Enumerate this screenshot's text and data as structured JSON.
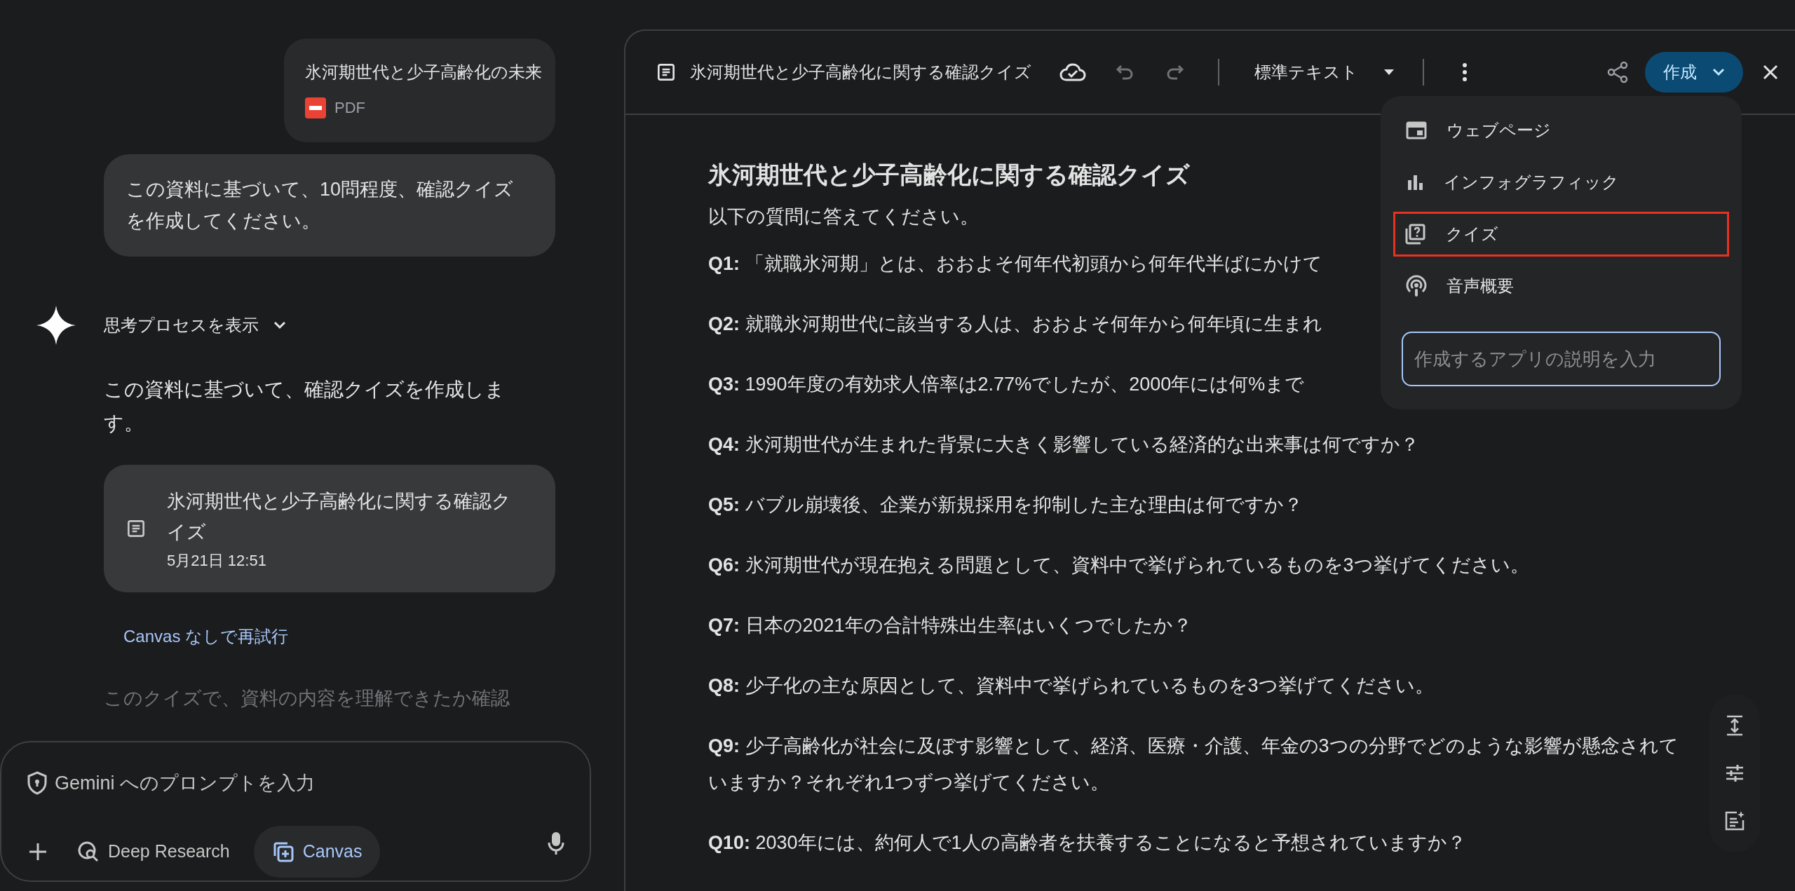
{
  "chat": {
    "file": {
      "name": "氷河期世代と少子高齢化の未来",
      "type": "PDF"
    },
    "user_message": "この資料に基づいて、10問程度、確認クイズを作成してください。",
    "thinking": {
      "label": "思考プロセスを表示",
      "expanded": false
    },
    "response": "この資料に基づいて、確認クイズを作成します。",
    "canvas_card": {
      "title": "氷河期世代と少子高齢化に関する確認クイズ",
      "date": "5月21日 12:51"
    },
    "retry_link": "Canvas なしで再試行",
    "faded_text": "このクイズで、資料の内容を理解できたか確認"
  },
  "prompt": {
    "placeholder": "Gemini へのプロンプトを入力",
    "tools": [
      {
        "label": "Deep Research",
        "selected": false
      },
      {
        "label": "Canvas",
        "selected": true
      }
    ]
  },
  "canvas": {
    "title": "氷河期世代と少子高齢化に関する確認クイズ",
    "text_style": "標準テキスト",
    "create_button": "作成",
    "document": {
      "heading": "氷河期世代と少子高齢化に関する確認クイズ",
      "intro": "以下の質問に答えてください。",
      "questions": [
        "**Q1:** 「就職氷河期」とは、おおよそ何年代初頭から何年代半ばにかけて",
        "**Q2:** 就職氷河期世代に該当する人は、おおよそ何年から何年頃に生まれ",
        "**Q3:** 1990年度の有効求人倍率は2.77%でしたが、2000年には何%まで",
        "**Q4:** 氷河期世代が生まれた背景に大きく影響している経済的な出来事は何ですか？",
        "**Q5:** バブル崩壊後、企業が新規採用を抑制した主な理由は何ですか？",
        "**Q6:** 氷河期世代が現在抱える問題として、資料中で挙げられているものを3つ挙げてください。",
        "**Q7:** 日本の2021年の合計特殊出生率はいくつでしたか？",
        "**Q8:** 少子化の主な原因として、資料中で挙げられているものを3つ挙げてください。",
        "**Q9:** 少子高齢化が社会に及ぼす影響として、経済、医療・介護、年金の3つの分野でどのような影響が懸念されていますか？それぞれ1つずつ挙げてください。",
        "**Q10:** 2030年には、約何人で1人の高齢者を扶養することになると予想されていますか？"
      ]
    }
  },
  "create_menu": {
    "items": [
      {
        "label": "ウェブページ",
        "highlighted": false
      },
      {
        "label": "インフォグラフィック",
        "highlighted": false
      },
      {
        "label": "クイズ",
        "highlighted": true
      },
      {
        "label": "音声概要",
        "highlighted": false
      }
    ],
    "input_placeholder": "作成するアプリの説明を入力"
  }
}
